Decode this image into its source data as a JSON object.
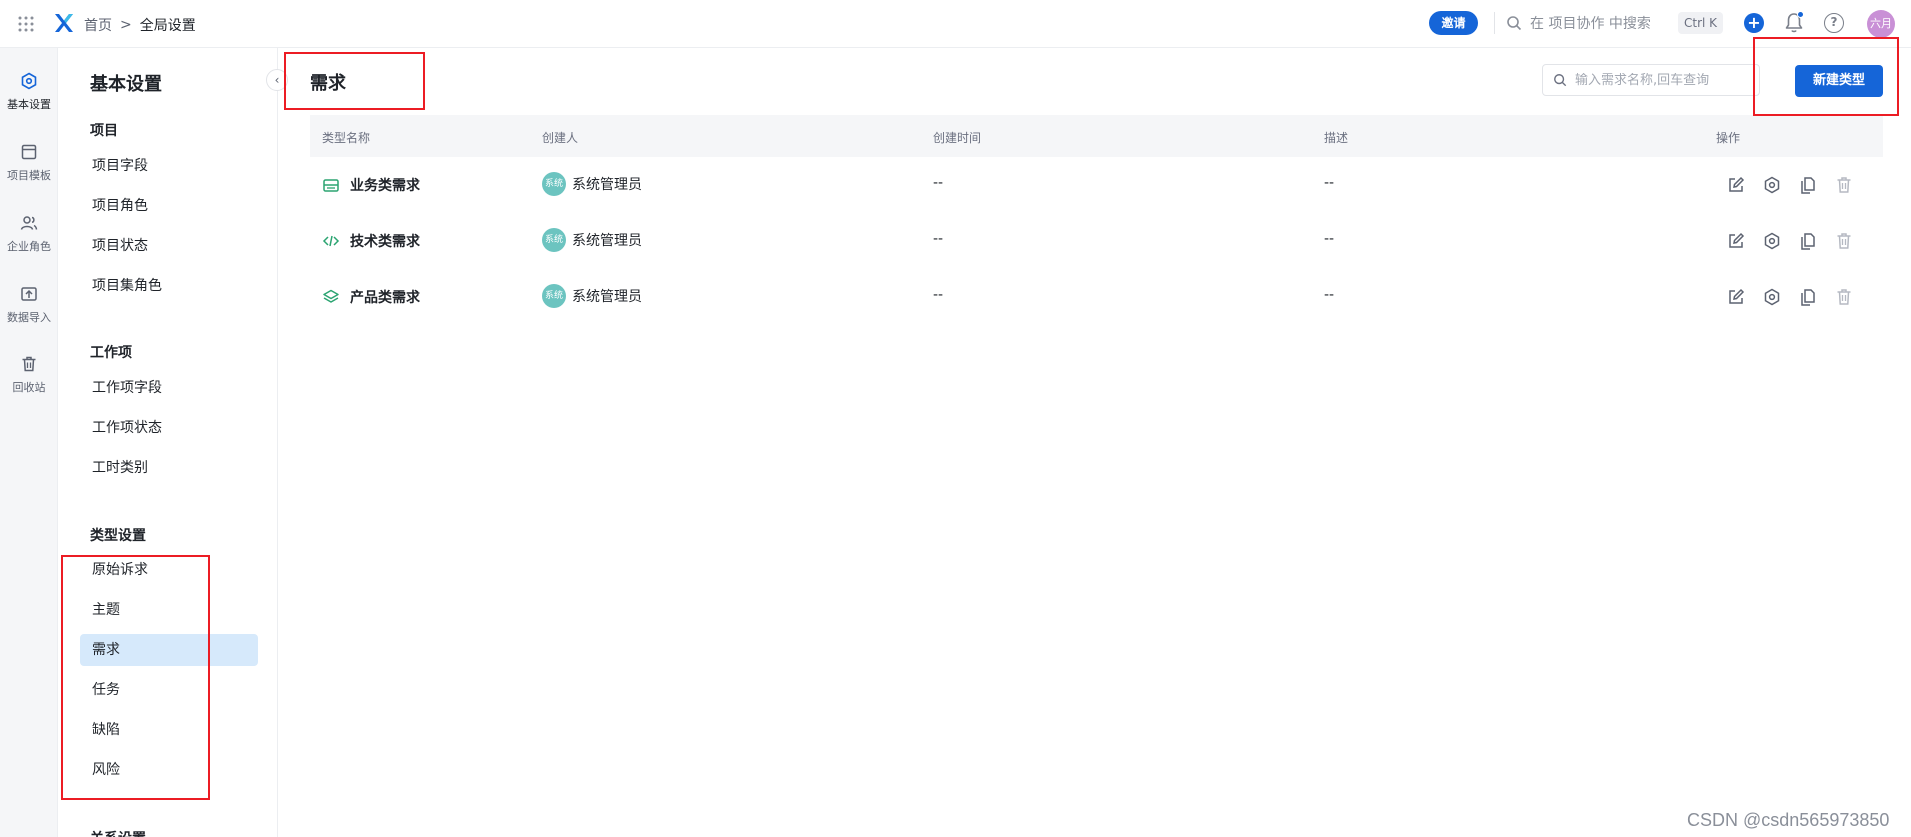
{
  "topbar": {
    "breadcrumb_home": "首页",
    "breadcrumb_sep": ">",
    "breadcrumb_current": "全局设置",
    "invite_label": "邀请",
    "search_placeholder": "在 项目协作 中搜索",
    "search_shortcut": "Ctrl K",
    "plus_label": "+",
    "help_label": "?",
    "avatar_text": "六月"
  },
  "rail": {
    "items": [
      {
        "label": "基本设置",
        "icon": "settings-hexagon-icon"
      },
      {
        "label": "项目模板",
        "icon": "template-icon"
      },
      {
        "label": "企业角色",
        "icon": "users-icon"
      },
      {
        "label": "数据导入",
        "icon": "import-icon"
      },
      {
        "label": "回收站",
        "icon": "trash-icon"
      }
    ]
  },
  "nav": {
    "title": "基本设置",
    "collapse": "‹",
    "groups": {
      "project": {
        "label": "项目",
        "items": [
          "项目字段",
          "项目角色",
          "项目状态",
          "项目集角色"
        ]
      },
      "workitem": {
        "label": "工作项",
        "items": [
          "工作项字段",
          "工作项状态",
          "工时类别"
        ]
      },
      "types": {
        "label": "类型设置",
        "items": [
          "原始诉求",
          "主题",
          "需求",
          "任务",
          "缺陷",
          "风险"
        ]
      },
      "relation": {
        "label": "关系设置"
      }
    },
    "active_item": "需求"
  },
  "main": {
    "title": "需求",
    "search_placeholder": "输入需求名称,回车查询",
    "new_button": "新建类型",
    "columns": [
      "类型名称",
      "创建人",
      "创建时间",
      "描述",
      "操作"
    ],
    "rows": [
      {
        "name": "业务类需求",
        "icon": "briefcase-icon",
        "creator": "系统管理员",
        "creator_avatar": "系统",
        "created": "--",
        "desc": "--"
      },
      {
        "name": "技术类需求",
        "icon": "code-icon",
        "creator": "系统管理员",
        "creator_avatar": "系统",
        "created": "--",
        "desc": "--"
      },
      {
        "name": "产品类需求",
        "icon": "layers-icon",
        "creator": "系统管理员",
        "creator_avatar": "系统",
        "created": "--",
        "desc": "--"
      }
    ]
  },
  "watermark": "CSDN @csdn565973850",
  "colors": {
    "primary": "#1565d8",
    "accent_green": "#2ba471",
    "highlight_red": "#ec1c24",
    "active_nav": "#d6e9fb"
  }
}
